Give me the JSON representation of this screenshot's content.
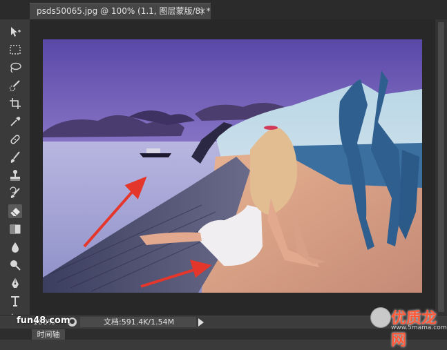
{
  "document": {
    "tab_title": "psds50065.jpg @ 100% (1.1, 图层蒙版/8) *",
    "close_glyph": "×"
  },
  "tools": [
    {
      "name": "move-tool-icon"
    },
    {
      "name": "marquee-tool-icon"
    },
    {
      "name": "lasso-tool-icon"
    },
    {
      "name": "quick-selection-tool-icon"
    },
    {
      "name": "crop-tool-icon"
    },
    {
      "name": "eyedropper-tool-icon"
    },
    {
      "name": "healing-brush-tool-icon"
    },
    {
      "name": "brush-tool-icon"
    },
    {
      "name": "clone-stamp-tool-icon"
    },
    {
      "name": "history-brush-tool-icon"
    },
    {
      "name": "eraser-tool-icon",
      "active": true
    },
    {
      "name": "gradient-tool-icon"
    },
    {
      "name": "blur-tool-icon"
    },
    {
      "name": "dodge-tool-icon"
    },
    {
      "name": "pen-tool-icon"
    },
    {
      "name": "type-tool-icon"
    },
    {
      "name": "path-selection-tool-icon"
    },
    {
      "name": "rectangle-tool-icon"
    }
  ],
  "status": {
    "zoom": "100%",
    "doc_info": "文档:591.4K/1.54M"
  },
  "timeline": {
    "tab_label": "时间轴"
  },
  "watermarks": {
    "left": "fun48.com",
    "right_cn": "优质龙网",
    "right_en": "www.5mama.com"
  },
  "colors": {
    "annotation_arrow": "#e5362b",
    "accent_panel": "#3a3a3a"
  }
}
